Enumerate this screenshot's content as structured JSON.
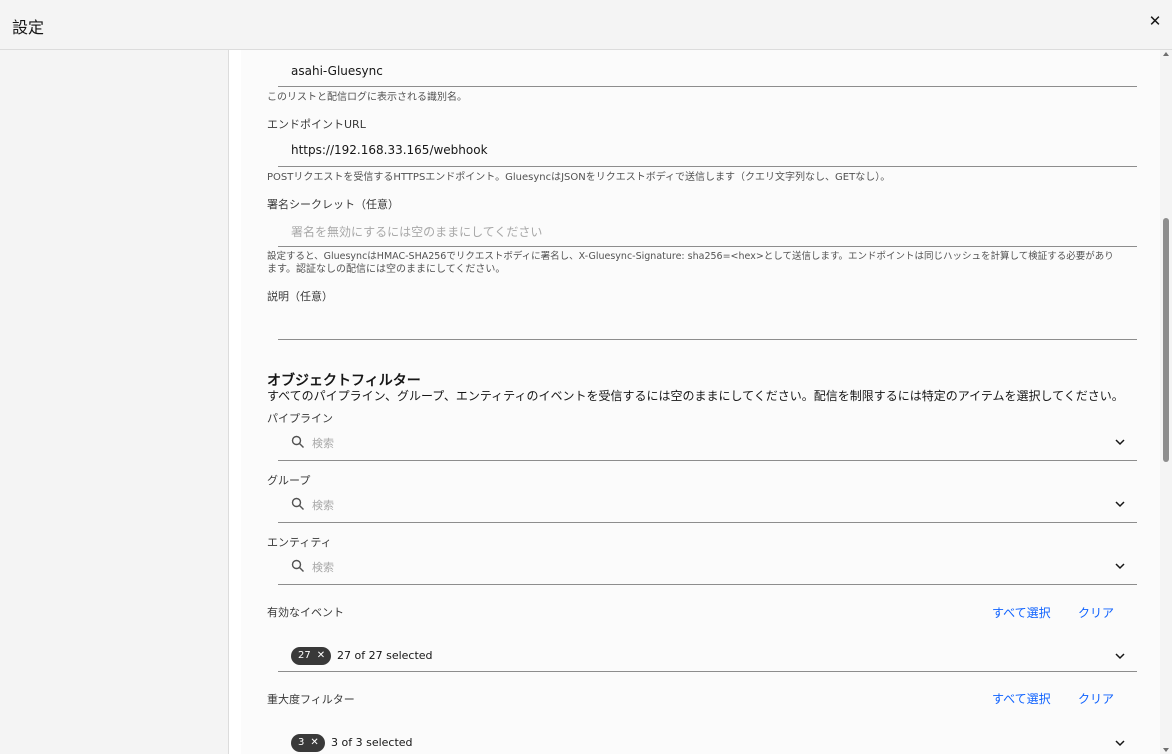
{
  "header": {
    "title": "設定",
    "close_icon": "close-icon"
  },
  "form": {
    "name": {
      "value": "asahi-Gluesync",
      "helper": "このリストと配信ログに表示される識別名。"
    },
    "endpoint": {
      "label": "エンドポイントURL",
      "value": "https://192.168.33.165/webhook",
      "helper": "POSTリクエストを受信するHTTPSエンドポイント。GluesyncはJSONをリクエストボディで送信します（クエリ文字列なし、GETなし）。"
    },
    "secret": {
      "label": "署名シークレット（任意）",
      "placeholder": "署名を無効にするには空のままにしてください",
      "helper_line1": "設定すると、GluesyncはHMAC-SHA256でリクエストボディに署名し、X-Gluesync-Signature: sha256=<hex>として送信します。エンドポイントは同じハッシュを計算して検証する必要があり",
      "helper_line2": "ます。認証なしの配信には空のままにしてください。"
    },
    "description": {
      "label": "説明（任意）",
      "value": ""
    }
  },
  "filters": {
    "title": "オブジェクトフィルター",
    "description": "すべてのパイプライン、グループ、エンティティのイベントを受信するには空のままにしてください。配信を制限するには特定のアイテムを選択してください。",
    "pipeline": {
      "label": "パイプライン",
      "placeholder": "検索"
    },
    "group": {
      "label": "グループ",
      "placeholder": "検索"
    },
    "entity": {
      "label": "エンティティ",
      "placeholder": "検索"
    }
  },
  "events": {
    "label": "有効なイベント",
    "select_all": "すべて選択",
    "clear": "クリア",
    "tag_count": "27",
    "selected_text": "27 of 27 selected"
  },
  "severity": {
    "label": "重大度フィルター",
    "select_all": "すべて選択",
    "clear": "クリア",
    "tag_count": "3",
    "selected_text": "3 of 3 selected"
  }
}
